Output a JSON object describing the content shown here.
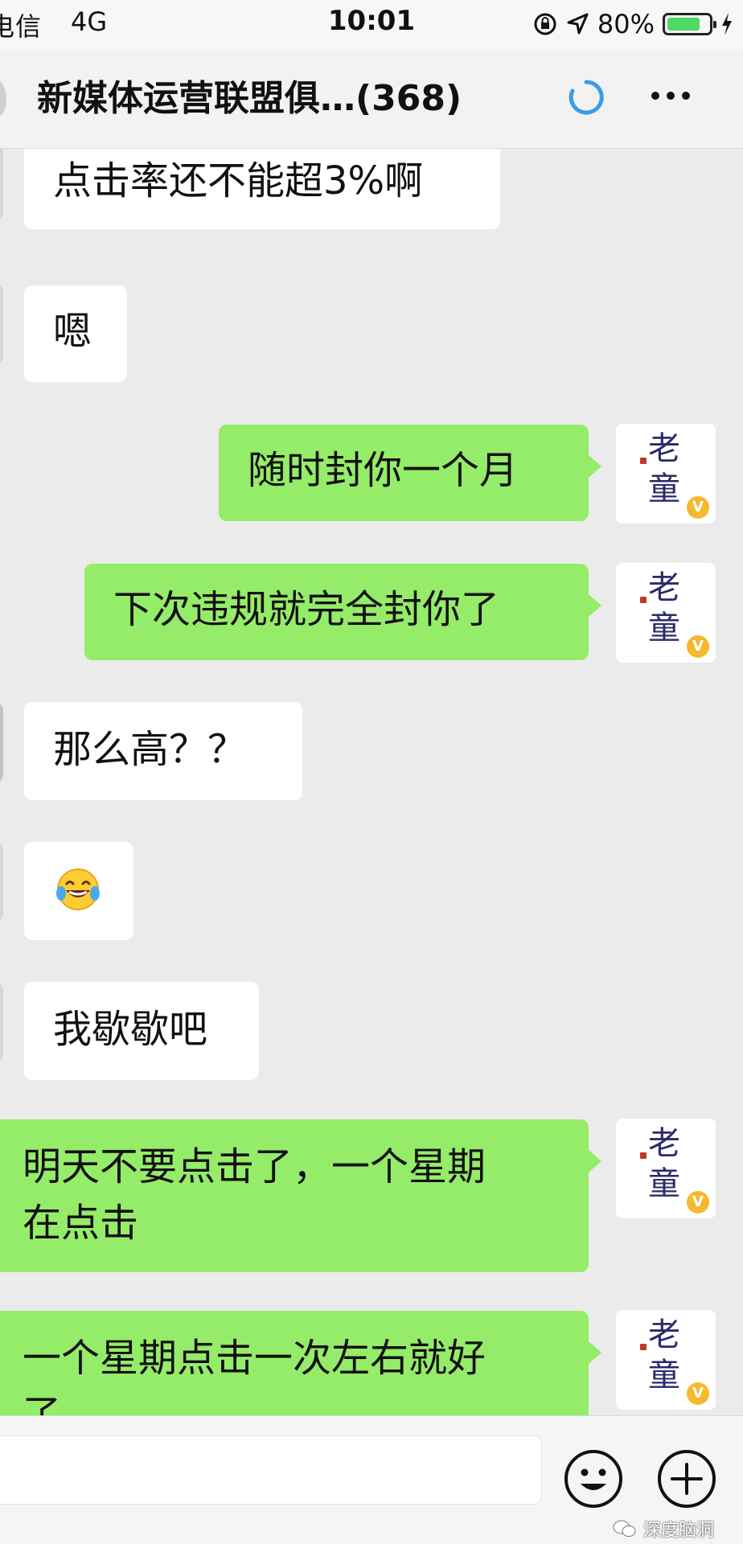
{
  "status_bar": {
    "carrier": "电信",
    "network": "4G",
    "time": "10:01",
    "battery_percent": "80%",
    "battery_level": 0.8,
    "icons": [
      "orientation-lock-icon",
      "location-arrow-icon",
      "battery-icon",
      "charging-bolt-icon"
    ]
  },
  "header": {
    "title": "新媒体运营联盟俱…(368)",
    "icons": [
      "loading-icon",
      "more-icon"
    ]
  },
  "messages": [
    {
      "side": "left",
      "text": "点击率还不能超3%啊"
    },
    {
      "side": "left",
      "text": "嗯"
    },
    {
      "side": "right",
      "text": "随时封你一个月",
      "avatar": {
        "line1": "老",
        "line2": "童",
        "badge": "V"
      }
    },
    {
      "side": "right",
      "text": "下次违规就完全封你了",
      "avatar": {
        "line1": "老",
        "line2": "童",
        "badge": "V"
      }
    },
    {
      "side": "left",
      "text": "那么高？？"
    },
    {
      "side": "left",
      "text": "",
      "emoji": "laughing-tears-emoji"
    },
    {
      "side": "left",
      "text": "我歇歇吧"
    },
    {
      "side": "right",
      "text": "明天不要点击了，一个星期\n在点击",
      "avatar": {
        "line1": "老",
        "line2": "童",
        "badge": "V"
      }
    },
    {
      "side": "right",
      "text": "一个星期点击一次左右就好\n了",
      "avatar": {
        "line1": "老",
        "line2": "童",
        "badge": "V"
      }
    }
  ],
  "input_bar": {
    "icons": [
      "emoji-icon",
      "plus-icon"
    ]
  },
  "watermark": {
    "text": "深度脑洞",
    "icon": "wechat-icon"
  }
}
